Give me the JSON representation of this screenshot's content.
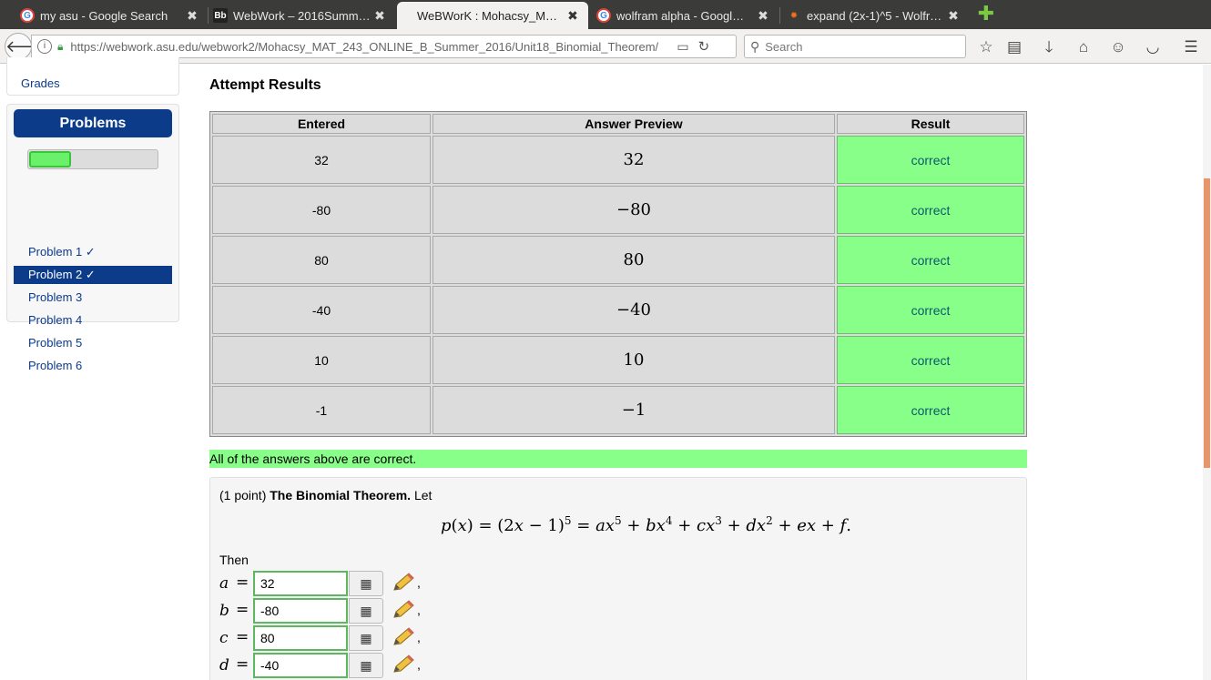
{
  "browser": {
    "tabs": [
      {
        "title": "my asu - Google Search",
        "favicon": "google-icon",
        "active": false
      },
      {
        "title": "WebWork – 2016Summ…",
        "favicon": "blackboard-icon",
        "active": false
      },
      {
        "title": "WeBWorK : Mohacsy_M…",
        "favicon": "none",
        "active": true
      },
      {
        "title": "wolfram alpha - Googl…",
        "favicon": "google-icon",
        "active": false
      },
      {
        "title": "expand (2x-1)^5 - Wolfr…",
        "favicon": "wolfram-icon",
        "active": false
      }
    ],
    "close_glyph": "✖",
    "new_tab_glyph": "✚",
    "url": "https://webwork.asu.edu/webwork2/Mohacsy_MAT_243_ONLINE_B_Summer_2016/Unit18_Binomial_Theorem/",
    "search_placeholder": "Search"
  },
  "sidebar": {
    "grades_label": "Grades",
    "problems_header": "Problems",
    "progress_fraction": 0.33,
    "items": [
      {
        "label": "Problem 1 ✓",
        "active": false
      },
      {
        "label": "Problem 2 ✓",
        "active": true
      },
      {
        "label": "Problem 3",
        "active": false
      },
      {
        "label": "Problem 4",
        "active": false
      },
      {
        "label": "Problem 5",
        "active": false
      },
      {
        "label": "Problem 6",
        "active": false
      }
    ]
  },
  "results": {
    "title": "Attempt Results",
    "headers": [
      "Entered",
      "Answer Preview",
      "Result"
    ],
    "rows": [
      {
        "entered": "32",
        "preview": "32",
        "result": "correct"
      },
      {
        "entered": "-80",
        "preview": "−80",
        "result": "correct"
      },
      {
        "entered": "80",
        "preview": "80",
        "result": "correct"
      },
      {
        "entered": "-40",
        "preview": "−40",
        "result": "correct"
      },
      {
        "entered": "10",
        "preview": "10",
        "result": "correct"
      },
      {
        "entered": "-1",
        "preview": "−1",
        "result": "correct"
      }
    ],
    "summary": "All of the answers above are correct.",
    "correct_color": "#88ff88"
  },
  "problem": {
    "points": "(1 point)",
    "name": "The Binomial Theorem.",
    "let": "Let",
    "then": "Then",
    "answers": [
      {
        "var": "a",
        "value": "32"
      },
      {
        "var": "b",
        "value": "-80"
      },
      {
        "var": "c",
        "value": "80"
      },
      {
        "var": "d",
        "value": "-40"
      }
    ]
  }
}
